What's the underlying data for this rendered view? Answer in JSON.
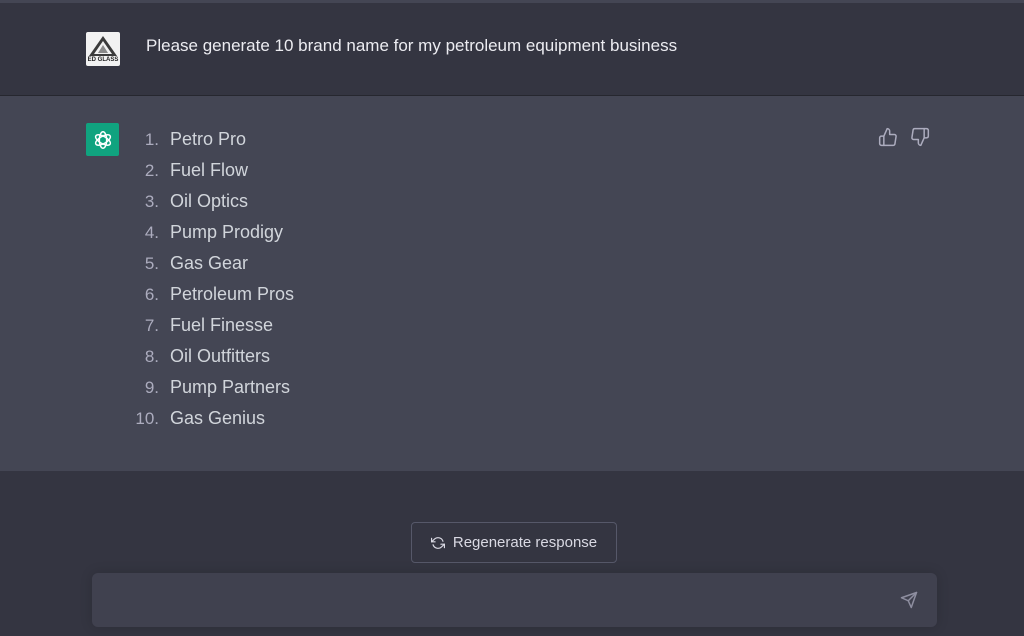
{
  "conversation": {
    "user": {
      "avatar_text": "ED GLASS",
      "message": "Please generate 10 brand name for my petroleum equipment business"
    },
    "assistant": {
      "items": [
        {
          "num": "1.",
          "text": "Petro Pro"
        },
        {
          "num": "2.",
          "text": "Fuel Flow"
        },
        {
          "num": "3.",
          "text": "Oil Optics"
        },
        {
          "num": "4.",
          "text": "Pump Prodigy"
        },
        {
          "num": "5.",
          "text": "Gas Gear"
        },
        {
          "num": "6.",
          "text": "Petroleum Pros"
        },
        {
          "num": "7.",
          "text": "Fuel Finesse"
        },
        {
          "num": "8.",
          "text": "Oil Outfitters"
        },
        {
          "num": "9.",
          "text": "Pump Partners"
        },
        {
          "num": "10.",
          "text": "Gas Genius"
        }
      ]
    }
  },
  "controls": {
    "regenerate_label": "Regenerate response",
    "input_placeholder": ""
  },
  "icons": {
    "user_avatar": "ed-glass-logo-icon",
    "assistant_avatar": "openai-logo-icon",
    "thumbs_up": "thumbs-up-icon",
    "thumbs_down": "thumbs-down-icon",
    "regenerate": "refresh-icon",
    "send": "send-icon"
  },
  "colors": {
    "background": "#343541",
    "assistant_background": "#444654",
    "assistant_avatar": "#10a37f",
    "composer": "#40414f"
  }
}
